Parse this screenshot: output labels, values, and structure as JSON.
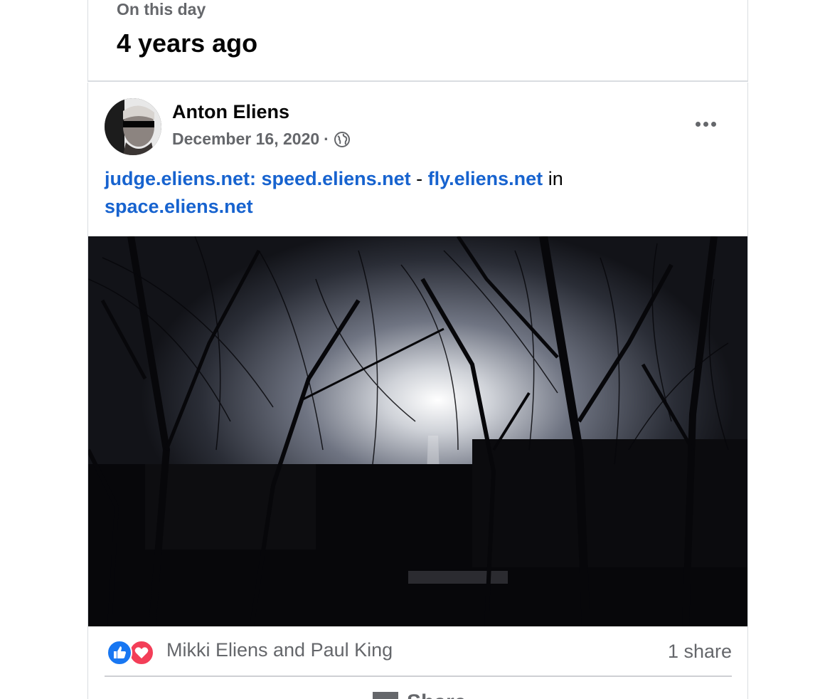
{
  "memory": {
    "label": "On this day",
    "title": "4 years ago"
  },
  "post": {
    "author": "Anton Eliens",
    "date": "December 16, 2020",
    "separator": "·",
    "privacy_icon": "globe-icon",
    "more_icon": "more-options-icon",
    "text": {
      "link1": "judge.eliens.net: speed.eliens.net",
      "sep": " - ",
      "link2": "fly.eliens.net",
      "mid": " in",
      "link3": "space.eliens.net"
    },
    "reactions": {
      "icons": [
        "like-icon",
        "love-icon"
      ],
      "names": "Mikki Eliens and Paul King",
      "shares": "1 share"
    },
    "actions": {
      "share_label": "Share"
    }
  },
  "colors": {
    "link": "#1763cf",
    "secondary_text": "#65676b",
    "like": "#1877f2",
    "love": "#f33e58",
    "divider": "#ced0d4"
  }
}
